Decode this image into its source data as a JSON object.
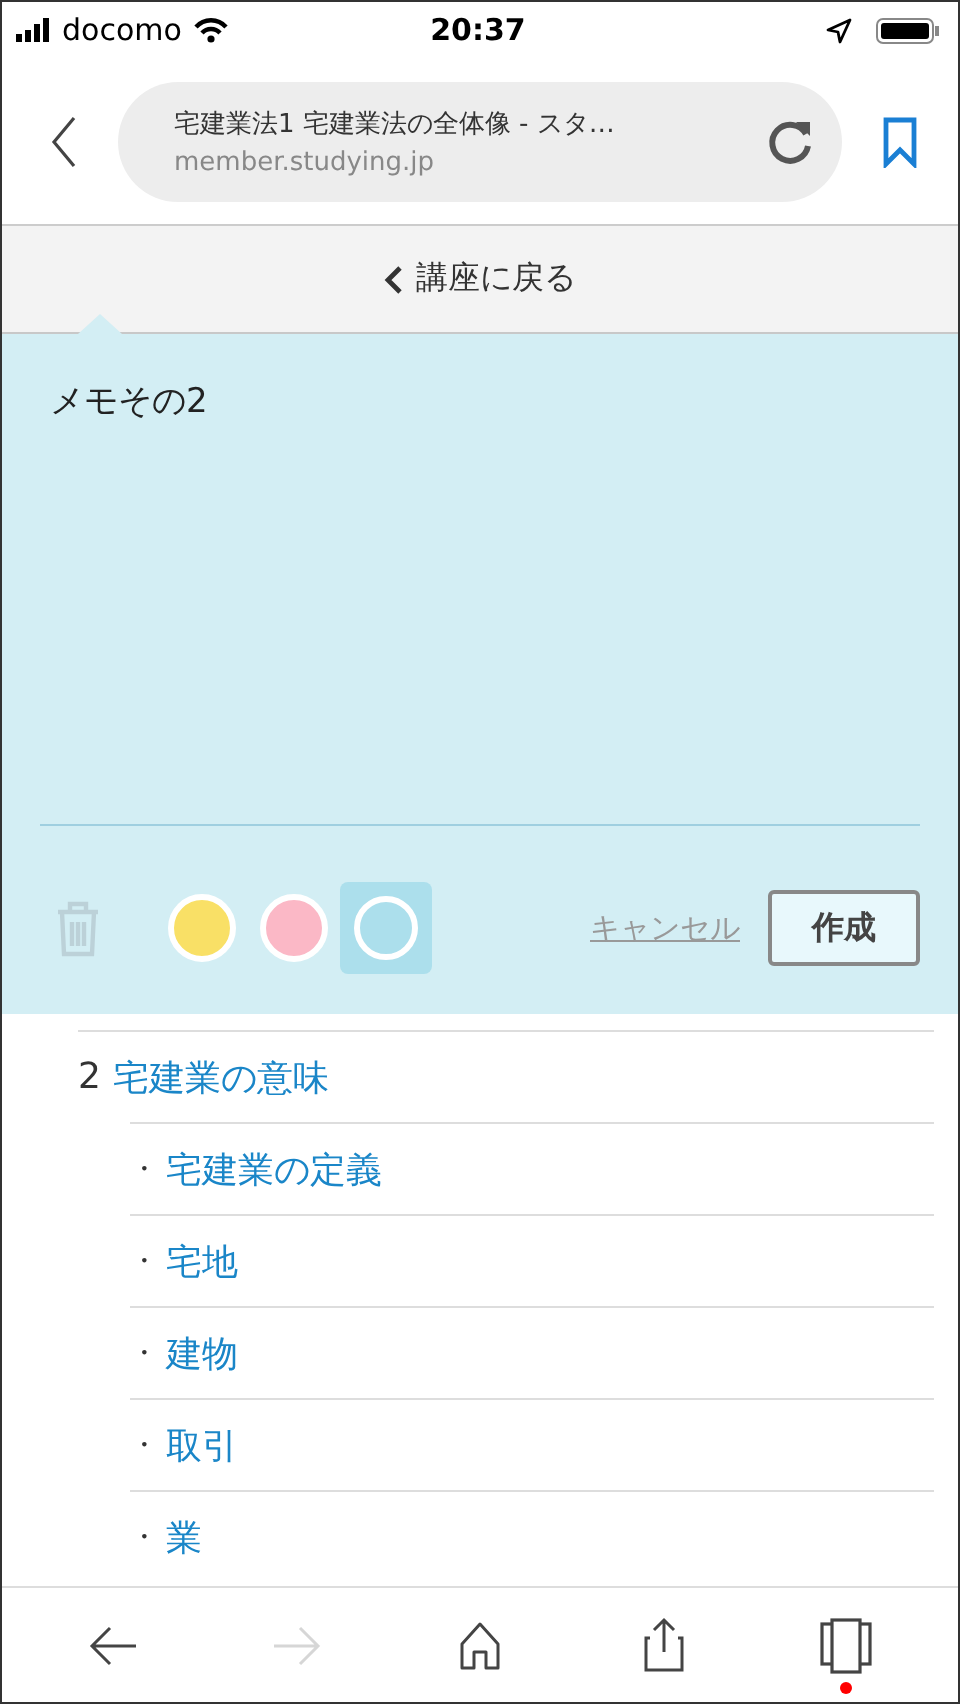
{
  "status_bar": {
    "carrier": "docomo",
    "time": "20:37"
  },
  "browser": {
    "page_title": "宅建業法1 宅建業法の全体像 - スタ…",
    "url": "member.studying.jp"
  },
  "back_link": "講座に戻る",
  "memo": {
    "value": "メモその2",
    "colors": [
      {
        "color": "#f9e066",
        "selected": false
      },
      {
        "color": "#fbb8c6",
        "selected": false
      },
      {
        "color": "#acdfec",
        "selected": true
      }
    ],
    "cancel": "キャンセル",
    "create": "作成"
  },
  "toc": [
    {
      "number": "2",
      "label": "宅建業の意味",
      "children": [
        {
          "bullet": "・",
          "label": "宅建業の定義"
        },
        {
          "bullet": "・",
          "label": "宅地"
        },
        {
          "bullet": "・",
          "label": "建物"
        },
        {
          "bullet": "・",
          "label": "取引"
        },
        {
          "bullet": "・",
          "label": "業"
        }
      ]
    }
  ],
  "toolbar": [
    {
      "kind": "back",
      "disabled": false
    },
    {
      "kind": "forward",
      "disabled": true
    },
    {
      "kind": "home",
      "disabled": false
    },
    {
      "kind": "share",
      "disabled": false
    },
    {
      "kind": "tabs",
      "disabled": false,
      "badge": true
    }
  ]
}
